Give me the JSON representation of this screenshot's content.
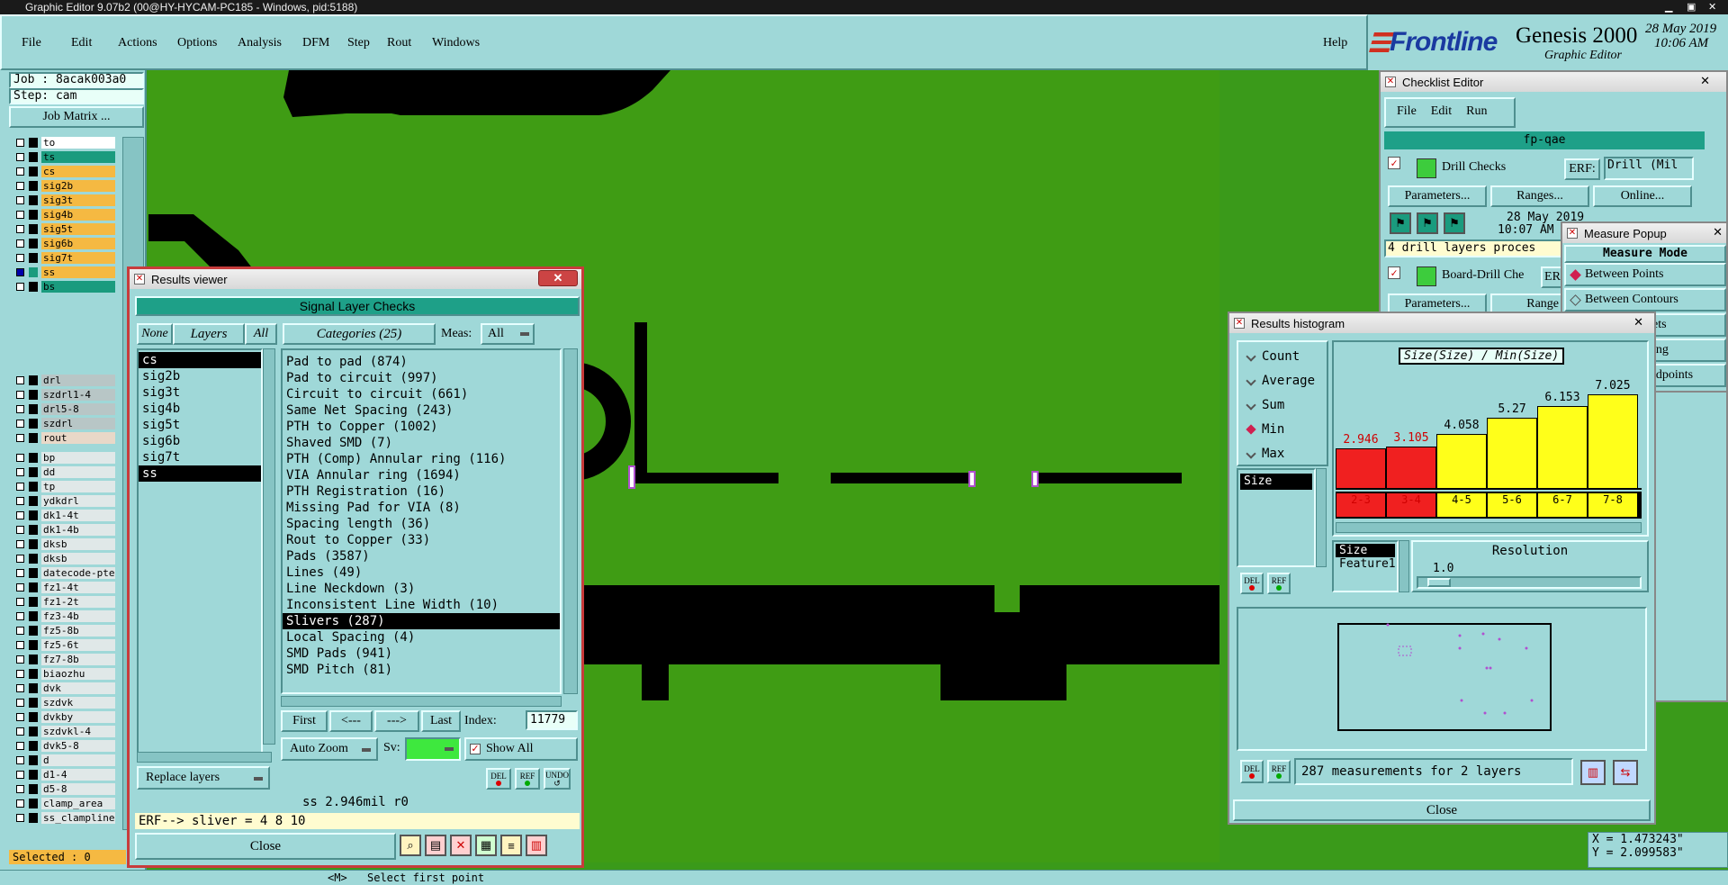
{
  "app": {
    "title_bar": "Graphic Editor 9.07b2 (00@HY-HYCAM-PC185 - Windows, pid:5188)",
    "menu": [
      "File",
      "Edit",
      "Actions",
      "Options",
      "Analysis",
      "DFM",
      "Step",
      "Rout",
      "Windows"
    ],
    "help": "Help",
    "brand": "Frontline",
    "product": "Genesis 2000",
    "product_sub": "Graphic Editor",
    "date": "28 May 2019",
    "time": "10:06 AM"
  },
  "left_panel": {
    "job": "Job : 8acak003a0",
    "step": "Step: cam",
    "job_matrix": "Job Matrix ...",
    "selected": "Selected : 0",
    "layers_group1": [
      {
        "name": "to",
        "color": "#ffffff"
      },
      {
        "name": "ts",
        "color": "#1a9b7e"
      },
      {
        "name": "cs",
        "color": "#f5b942"
      },
      {
        "name": "sig2b",
        "color": "#f5b942"
      },
      {
        "name": "sig3t",
        "color": "#f5b942"
      },
      {
        "name": "sig4b",
        "color": "#f5b942"
      },
      {
        "name": "sig5t",
        "color": "#f5b942"
      },
      {
        "name": "sig6b",
        "color": "#f5b942"
      },
      {
        "name": "sig7t",
        "color": "#f5b942"
      },
      {
        "name": "ss",
        "color": "#f5b942"
      },
      {
        "name": "bs",
        "color": "#1a9b7e"
      }
    ],
    "layers_group2": [
      {
        "name": "drl",
        "color": "#b8c6c6"
      },
      {
        "name": "szdrl1-4",
        "color": "#b8c6c6"
      },
      {
        "name": "drl5-8",
        "color": "#b8c6c6"
      },
      {
        "name": "szdrl",
        "color": "#b8c6c6"
      },
      {
        "name": "rout",
        "color": "#e8d8c8"
      }
    ],
    "layers_group3": [
      "bp",
      "dd",
      "tp",
      "ydkdrl",
      "dk1-4t",
      "dk1-4b",
      "dksb",
      "dksb",
      "datecode-pte",
      "fz1-4t",
      "fz1-2t",
      "fz3-4b",
      "fz5-8b",
      "fz5-6t",
      "fz7-8b",
      "biaozhu",
      "dvk",
      "szdvk",
      "dvkby",
      "szdvkl-4",
      "dvk5-8",
      "d",
      "d1-4",
      "d5-8",
      "clamp_area",
      "ss_clampline"
    ]
  },
  "results_viewer": {
    "title": "Results viewer",
    "heading": "Signal Layer Checks",
    "none_btn": "None",
    "layers_btn": "Layers",
    "all_btn": "All",
    "categories_label": "Categories (25)",
    "meas_label": "Meas:",
    "meas_value": "All",
    "layers": [
      "cs",
      "sig2b",
      "sig3t",
      "sig4b",
      "sig5t",
      "sig6b",
      "sig7t",
      "ss"
    ],
    "categories": [
      "Pad to pad (874)",
      "Pad to circuit (997)",
      "Circuit to circuit (661)",
      "Same Net Spacing (243)",
      "PTH to Copper (1002)",
      "Shaved SMD (7)",
      "PTH (Comp) Annular ring (116)",
      "VIA Annular ring (1694)",
      "PTH Registration (16)",
      "Missing Pad for VIA (8)",
      "Spacing length (36)",
      "Rout to Copper (33)",
      "Pads (3587)",
      "Lines (49)",
      "Line Neckdown (3)",
      "Inconsistent Line Width (10)",
      "Slivers (287)",
      "Local Spacing (4)",
      "SMD Pads (941)",
      "SMD Pitch (81)"
    ],
    "selected_category": "Slivers (287)",
    "first_btn": "First",
    "prev_btn": "<---",
    "next_btn": "--->",
    "last_btn": "Last",
    "index_label": "Index:",
    "index_value": "11779",
    "auto_zoom": "Auto Zoom",
    "sv_label": "Sv:",
    "show_all": "Show All",
    "replace_layers": "Replace layers",
    "del": "DEL",
    "ref": "REF",
    "undo": "UNDO",
    "status": "ss 2.946mil  r0",
    "erf_line": "ERF--> sliver = 4 8 10",
    "close": "Close"
  },
  "checklist_editor": {
    "title": "Checklist Editor",
    "menu": [
      "File",
      "Edit",
      "Run"
    ],
    "checklist_name": "fp-qae",
    "drill_checks": "Drill Checks",
    "erf_label": "ERF:",
    "erf_value": "Drill (Mil",
    "parameters": "Parameters...",
    "ranges": "Ranges...",
    "online": "Online...",
    "date": "28 May 2019",
    "time": "10:07 AM",
    "message": "4 drill layers proces",
    "board_drill": "Board-Drill Che",
    "erf_short": "ER",
    "ranges_short": "Range"
  },
  "measure_popup": {
    "title": "Measure Popup",
    "heading": "Measure Mode",
    "options": [
      "Between Points",
      "Between Contours"
    ],
    "partial": [
      "ets",
      "ing",
      "idpoints"
    ]
  },
  "histogram": {
    "title": "Results histogram",
    "modes": [
      "Count",
      "Average",
      "Sum",
      "Min",
      "Max"
    ],
    "selected_mode": "Min",
    "left_list": [
      "Size"
    ],
    "chart_title": "Size(Size) / Min(Size)",
    "feature_list": [
      "Size",
      "Feature1"
    ],
    "resolution_label": "Resolution",
    "resolution_value": "1.0",
    "summary": "287 measurements for 2 layers",
    "close": "Close",
    "del": "DEL",
    "ref": "REF"
  },
  "chart_data": {
    "type": "bar",
    "categories": [
      "2-3",
      "3-4",
      "4-5",
      "5-6",
      "6-7",
      "7-8"
    ],
    "values": [
      2.946,
      3.105,
      4.058,
      5.27,
      6.153,
      7.025
    ],
    "value_labels": [
      "2.946",
      "3.105",
      "4.058",
      "5.27",
      "6.153",
      "7.025"
    ],
    "colors": [
      "#f02020",
      "#f02020",
      "#ffff1a",
      "#ffff1a",
      "#ffff1a",
      "#ffff1a"
    ],
    "label_colors": [
      "#d00000",
      "#d00000",
      "#000000",
      "#000000",
      "#000000",
      "#000000"
    ],
    "title": "Size(Size) / Min(Size)",
    "ylim": [
      0,
      7.025
    ]
  },
  "coords": {
    "x": "X = 1.473243\"",
    "y": "Y = 2.099583\""
  },
  "bottom_bar": {
    "prompt": "Select first point",
    "prefix": "<M>"
  }
}
